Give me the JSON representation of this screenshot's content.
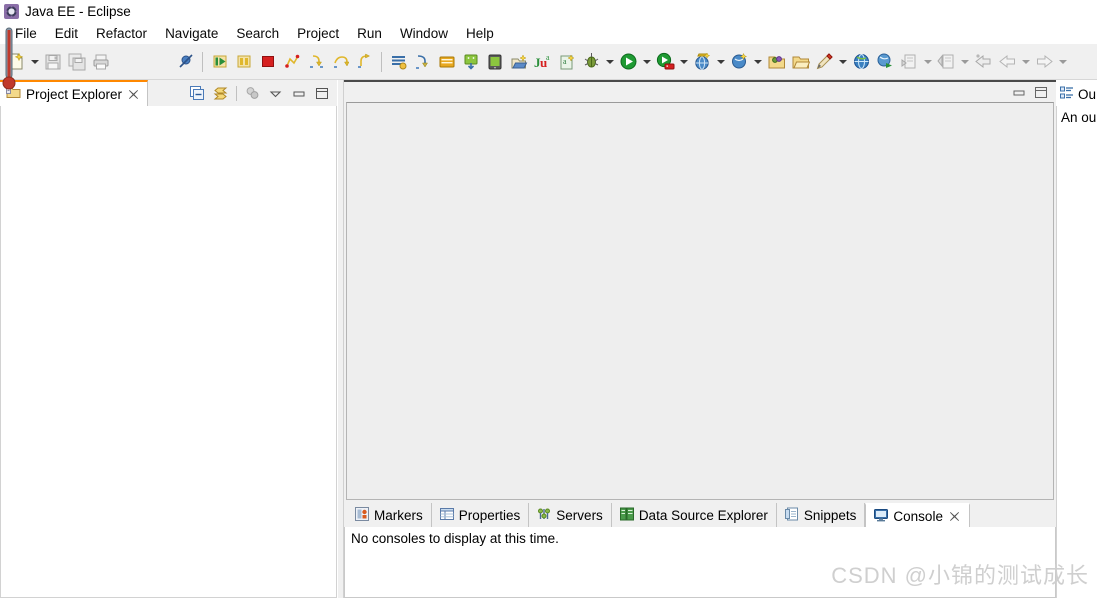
{
  "window": {
    "title": "Java EE - Eclipse",
    "app_icon": "eclipse-icon"
  },
  "menubar": {
    "items": [
      {
        "label": "File",
        "name": "menu-file"
      },
      {
        "label": "Edit",
        "name": "menu-edit"
      },
      {
        "label": "Refactor",
        "name": "menu-refactor"
      },
      {
        "label": "Navigate",
        "name": "menu-navigate"
      },
      {
        "label": "Search",
        "name": "menu-search"
      },
      {
        "label": "Project",
        "name": "menu-project"
      },
      {
        "label": "Run",
        "name": "menu-run"
      },
      {
        "label": "Window",
        "name": "menu-window"
      },
      {
        "label": "Help",
        "name": "menu-help"
      }
    ]
  },
  "toolbar": {
    "groups": [
      {
        "name": "file-group",
        "buttons": [
          {
            "icon": "new-file-icon",
            "enabled": true,
            "dropdown": true
          },
          {
            "icon": "save-icon",
            "enabled": false,
            "dropdown": false
          },
          {
            "icon": "save-all-icon",
            "enabled": false,
            "dropdown": false
          },
          {
            "icon": "print-icon",
            "enabled": false,
            "dropdown": false
          }
        ]
      },
      {
        "name": "debug-group",
        "buttons": [
          {
            "icon": "skip-breakpoints-icon",
            "enabled": true,
            "dropdown": false
          },
          {
            "icon": "resume-icon",
            "enabled": true,
            "dropdown": false
          },
          {
            "icon": "suspend-icon",
            "enabled": true,
            "dropdown": false
          },
          {
            "icon": "terminate-icon",
            "enabled": true,
            "dropdown": false
          },
          {
            "icon": "disconnect-icon",
            "enabled": true,
            "dropdown": false
          },
          {
            "icon": "step-into-icon",
            "enabled": true,
            "dropdown": false
          },
          {
            "icon": "step-over-icon",
            "enabled": true,
            "dropdown": false
          },
          {
            "icon": "step-return-icon",
            "enabled": true,
            "dropdown": false
          }
        ]
      },
      {
        "name": "android-group",
        "buttons": [
          {
            "icon": "logcat-icon",
            "enabled": true,
            "dropdown": false
          },
          {
            "icon": "ddms-icon",
            "enabled": true,
            "dropdown": false
          },
          {
            "icon": "sdk-manager-icon",
            "enabled": true,
            "dropdown": false
          },
          {
            "icon": "avd-manager-icon",
            "enabled": true,
            "dropdown": false
          },
          {
            "icon": "android-device-icon",
            "enabled": true,
            "dropdown": false
          },
          {
            "icon": "new-android-project-icon",
            "enabled": true,
            "dropdown": false
          },
          {
            "icon": "junit-icon",
            "enabled": true,
            "dropdown": false
          },
          {
            "icon": "new-android-xml-icon",
            "enabled": true,
            "dropdown": false
          }
        ]
      },
      {
        "name": "launch-group",
        "buttons": [
          {
            "icon": "debug-icon",
            "enabled": true,
            "dropdown": true
          },
          {
            "icon": "run-icon",
            "enabled": true,
            "dropdown": true
          },
          {
            "icon": "run-on-server-icon",
            "enabled": true,
            "dropdown": true
          },
          {
            "icon": "web-browser-icon",
            "enabled": true,
            "dropdown": true
          },
          {
            "icon": "new-project-wizard-icon",
            "enabled": true,
            "dropdown": true
          }
        ]
      },
      {
        "name": "misc-group",
        "buttons": [
          {
            "icon": "new-package-icon",
            "enabled": true,
            "dropdown": false
          },
          {
            "icon": "open-folder-icon",
            "enabled": true,
            "dropdown": false
          },
          {
            "icon": "pencil-icon",
            "enabled": true,
            "dropdown": true
          },
          {
            "icon": "globe-icon",
            "enabled": true,
            "dropdown": false
          },
          {
            "icon": "search-globe-icon",
            "enabled": true,
            "dropdown": false
          },
          {
            "icon": "annotation-icon",
            "enabled": false,
            "dropdown": true
          },
          {
            "icon": "last-edit-icon",
            "enabled": false,
            "dropdown": true
          }
        ]
      },
      {
        "name": "navigation-group",
        "buttons": [
          {
            "icon": "back-history-icon",
            "enabled": false,
            "dropdown": false
          },
          {
            "icon": "back-arrow-icon",
            "enabled": false,
            "dropdown": true
          },
          {
            "icon": "forward-arrow-icon",
            "enabled": false,
            "dropdown": true
          }
        ]
      }
    ]
  },
  "explorer": {
    "tab_label": "Project Explorer",
    "tab_icon": "project-explorer-icon",
    "close_icon": "close-icon",
    "toolbar": [
      {
        "icon": "collapse-all-icon",
        "enabled": true
      },
      {
        "icon": "link-with-editor-icon",
        "enabled": true
      },
      {
        "icon": "focus-on-active-task-icon",
        "enabled": false
      },
      {
        "icon": "view-menu-icon",
        "enabled": true
      },
      {
        "icon": "minimize-icon",
        "enabled": true
      },
      {
        "icon": "maximize-icon",
        "enabled": true
      }
    ],
    "content": ""
  },
  "editor": {
    "content": "",
    "controls": [
      {
        "icon": "minimize-icon",
        "enabled": true
      },
      {
        "icon": "maximize-icon",
        "enabled": true
      }
    ]
  },
  "bottom_panel": {
    "tabs": [
      {
        "label": "Markers",
        "icon": "markers-icon",
        "active": false,
        "closable": false
      },
      {
        "label": "Properties",
        "icon": "properties-icon",
        "active": false,
        "closable": false
      },
      {
        "label": "Servers",
        "icon": "servers-icon",
        "active": false,
        "closable": false
      },
      {
        "label": "Data Source Explorer",
        "icon": "data-source-explorer-icon",
        "active": false,
        "closable": false
      },
      {
        "label": "Snippets",
        "icon": "snippets-icon",
        "active": false,
        "closable": false
      },
      {
        "label": "Console",
        "icon": "console-icon",
        "active": true,
        "closable": true
      }
    ],
    "console_message": "No consoles to display at this time."
  },
  "outline": {
    "tab_label": "Ou",
    "tab_icon": "outline-icon",
    "body_text": "An ou"
  },
  "watermark": {
    "text": "CSDN @小锦的测试成长"
  },
  "overlay": {
    "thermometer_icon": "thermometer-icon"
  },
  "colors": {
    "accent_orange": "#ff8800",
    "toolbar_bg": "#f0f0f0",
    "editor_bg": "#eeeeee",
    "panel_white": "#ffffff",
    "run_green": "#22aa33",
    "terminate_red": "#cc2222"
  }
}
